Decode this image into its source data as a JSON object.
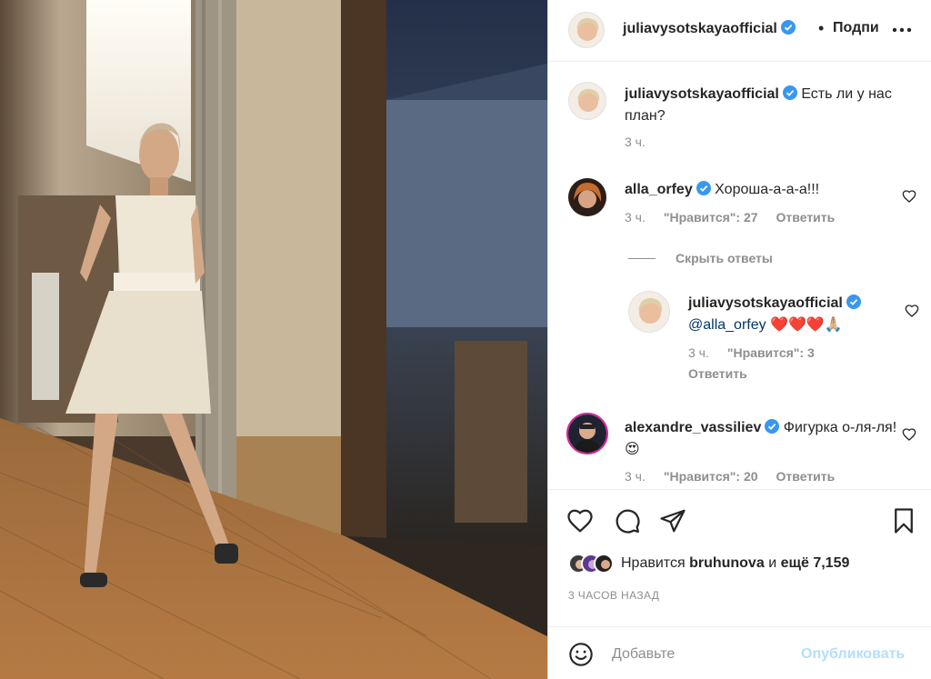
{
  "post": {
    "author": "juliavysotskayaofficial",
    "follow_label": "Подписаться",
    "caption": "Есть ли у нас план?",
    "caption_time": "3 ч."
  },
  "comments": [
    {
      "username": "alla_orfey",
      "text": "Хороша-а-а-а!!!",
      "time": "3 ч.",
      "likes": "\"Нравится\": 27",
      "reply": "Ответить"
    },
    {
      "username": "alexandre_vassiliev",
      "text": "Фигурка о-ля-ля!😍",
      "time": "3 ч.",
      "likes": "\"Нравится\": 20",
      "reply": "Ответить"
    }
  ],
  "hide_replies": "Скрыть ответы",
  "reply_comment": {
    "username": "juliavysotskayaofficial",
    "mention": "@alla_orfey",
    "emoji": "❤️❤️❤️🙏🏼",
    "time": "3 ч.",
    "likes": "\"Нравится\": 3",
    "reply": "Ответить"
  },
  "likes_summary": {
    "prefix": "Нравится",
    "user": "bruhunova",
    "middle": "и",
    "count": "ещё 7,159"
  },
  "time_ago": "3 ЧАСОВ НАЗАД",
  "add_comment": {
    "placeholder": "Добавьте",
    "publish": "Опубликовать"
  },
  "icons": [
    "more-icon",
    "heart-icon",
    "comment-icon",
    "share-icon",
    "bookmark-icon",
    "emoji-icon",
    "verified-icon"
  ],
  "colors": {
    "verified": "#3897f0",
    "link": "#00376b",
    "muted": "#8e8e8e",
    "publish_disabled": "#b2dffc"
  }
}
